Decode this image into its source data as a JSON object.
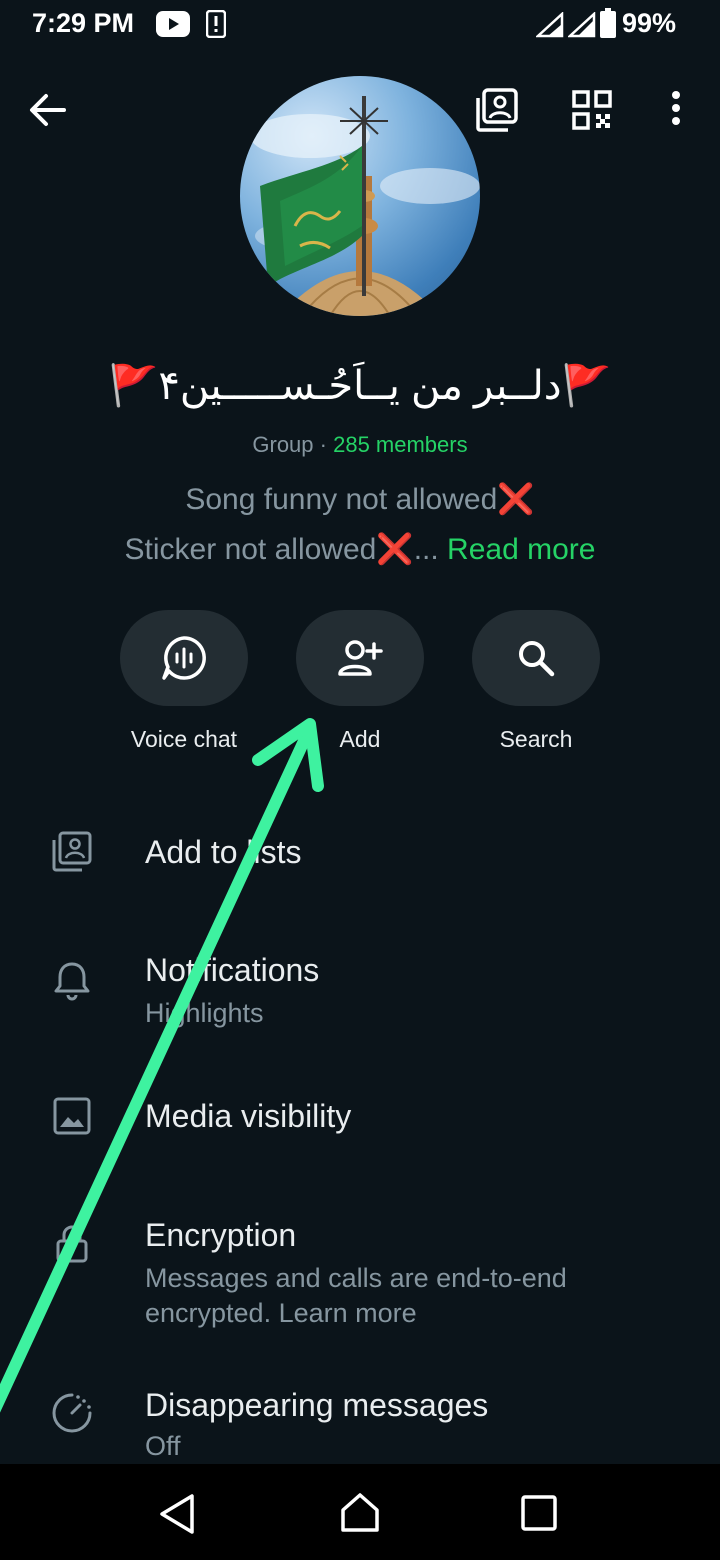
{
  "status_bar": {
    "time": "7:29 PM",
    "battery": "99%",
    "icons": [
      "youtube-icon",
      "alert-icon",
      "signal-icon",
      "signal-icon",
      "battery-icon"
    ]
  },
  "header": {
    "back_icon": "arrow-left-icon",
    "right_icons": [
      "add-to-list-icon",
      "qr-code-icon",
      "more-vertical-icon"
    ]
  },
  "group": {
    "name": "🚩دلــبر من یــاَحُـســـــین۴🚩",
    "type_label": "Group",
    "separator": " · ",
    "members": "285 members",
    "description_line1": "Song funny not allowed",
    "description_line2": "Sticker  not  allowed",
    "x_mark": "❌",
    "ellipsis": "... ",
    "read_more": "Read more"
  },
  "actions": [
    {
      "label": "Voice chat",
      "icon": "voice-chat-icon"
    },
    {
      "label": "Add",
      "icon": "add-person-icon"
    },
    {
      "label": "Search",
      "icon": "search-icon"
    }
  ],
  "settings": {
    "add_to_lists": {
      "title": "Add to lists",
      "icon": "add-to-list-icon"
    },
    "notifications": {
      "title": "Notifications",
      "subtitle": "Highlights",
      "icon": "bell-icon"
    },
    "media_visibility": {
      "title": "Media visibility",
      "icon": "image-icon"
    },
    "encryption": {
      "title": "Encryption",
      "subtitle": "Messages and calls are end-to-end encrypted. Learn more",
      "icon": "lock-icon"
    },
    "disappearing": {
      "title": "Disappearing messages",
      "subtitle": "Off",
      "icon": "timer-icon"
    }
  },
  "nav_bar": {
    "icons": [
      "back-triangle-icon",
      "home-icon",
      "recents-icon"
    ]
  },
  "colors": {
    "background": "#0b141a",
    "accent_green": "#25d366",
    "annotation_arrow": "#3ef2a0",
    "muted_text": "#8696a0"
  }
}
